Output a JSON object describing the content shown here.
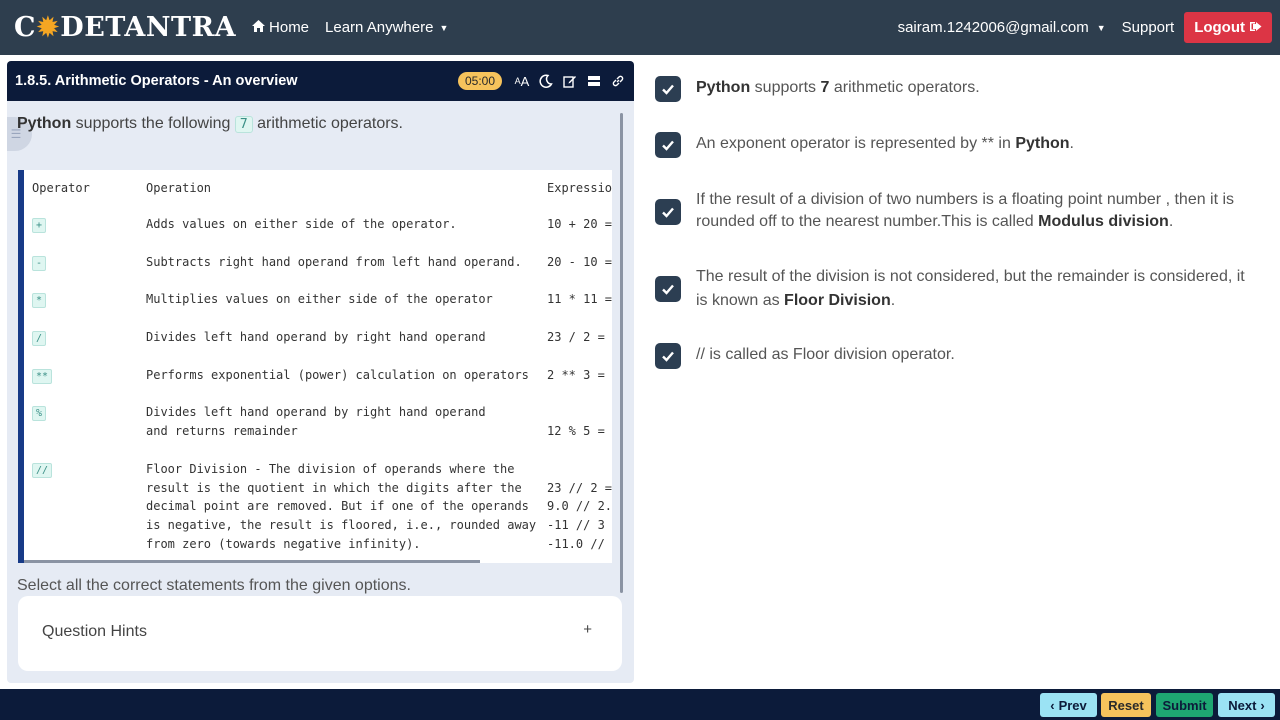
{
  "navbar": {
    "logo_left": "C",
    "logo_sun": "✹",
    "logo_right": "DETANTRA",
    "home": "Home",
    "learn": "Learn Anywhere",
    "user": "sairam.1242006@gmail.com",
    "support": "Support",
    "logout": "Logout"
  },
  "panel": {
    "title": "1.8.5. Arithmetic Operators - An overview",
    "timer": "05:00",
    "intro_strong": "Python",
    "intro_mid": " supports the following ",
    "intro_num": "7",
    "intro_end": " arithmetic operators.",
    "table": {
      "headers": [
        "Operator",
        "Operation",
        "Expressio"
      ],
      "rows": [
        {
          "op": "+",
          "operation": "Adds values on either side of the operator.",
          "expr": "10 + 20 ="
        },
        {
          "op": "-",
          "operation": "Subtracts right hand operand from left hand operand.",
          "expr": "20 - 10 ="
        },
        {
          "op": "*",
          "operation": "Multiplies values on either side of the operator",
          "expr": "11 * 11 ="
        },
        {
          "op": "/",
          "operation": "Divides left hand operand by right hand operand",
          "expr": "23 / 2 ="
        },
        {
          "op": "**",
          "operation": "Performs exponential (power) calculation on operators",
          "expr": "2 ** 3 ="
        },
        {
          "op": "%",
          "operation": "Divides left hand operand by right hand operand\nand returns remainder",
          "expr": "\n12 % 5 ="
        },
        {
          "op": "//",
          "operation": "Floor Division - The division of operands where the\nresult is the quotient in which the digits after the\ndecimal point are removed. But if one of the operands\nis negative, the result is floored, i.e., rounded away\nfrom zero (towards negative infinity).",
          "expr": "\n23 // 2 =\n9.0 // 2.\n-11 // 3\n-11.0 //"
        }
      ]
    },
    "select_text": "Select all the correct statements from the given options.",
    "hints_label": "Question Hints",
    "hints_toggle": "+"
  },
  "options": [
    {
      "pre": "",
      "strong1": "Python",
      "mid": " supports ",
      "strong2": "7",
      "post": " arithmetic operators."
    },
    {
      "pre": "An exponent operator is represented by ** in ",
      "strong1": "Python",
      "mid": ".",
      "strong2": "",
      "post": ""
    },
    {
      "pre": "If the result of a division of two numbers is a floating point number , then it is rounded off to the nearest number.This is called ",
      "strong1": "Modulus division",
      "mid": ".",
      "strong2": "",
      "post": ""
    },
    {
      "pre": "The result of the division is not considered, but the remainder is considered, it is known as ",
      "strong1": "Floor Division",
      "mid": ".",
      "strong2": "",
      "post": ""
    },
    {
      "pre": "// is called as Floor division operator.",
      "strong1": "",
      "mid": "",
      "strong2": "",
      "post": ""
    }
  ],
  "footer": {
    "prev": "Prev",
    "reset": "Reset",
    "submit": "Submit",
    "next": "Next"
  },
  "colors": {
    "navbar": "#2e3e4e",
    "panel_header": "#0c1b3a",
    "logout": "#dc3545",
    "timer": "#f6c35c",
    "submit": "#1ea672",
    "nav_buttons": "#9be3f4"
  }
}
